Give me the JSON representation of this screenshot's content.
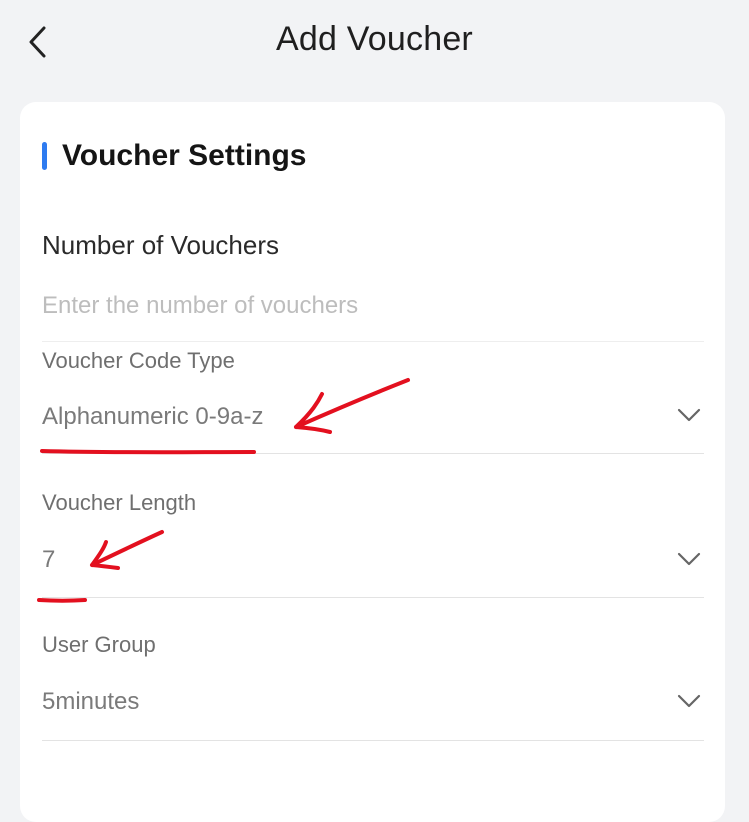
{
  "header": {
    "title": "Add Voucher",
    "back_icon": "chevron-left-icon"
  },
  "section": {
    "title": "Voucher Settings",
    "accent_color": "#2e7bf0"
  },
  "fields": {
    "number_of_vouchers": {
      "label": "Number of Vouchers",
      "value": "",
      "placeholder": "Enter the number of vouchers"
    },
    "voucher_code_type": {
      "label": "Voucher Code Type",
      "value": "Alphanumeric 0-9a-z",
      "icon": "chevron-down-icon"
    },
    "voucher_length": {
      "label": "Voucher Length",
      "value": "7",
      "icon": "chevron-down-icon"
    },
    "user_group": {
      "label": "User Group",
      "value": "5minutes",
      "icon": "chevron-down-icon"
    }
  },
  "annotation_color": "#e3101f"
}
